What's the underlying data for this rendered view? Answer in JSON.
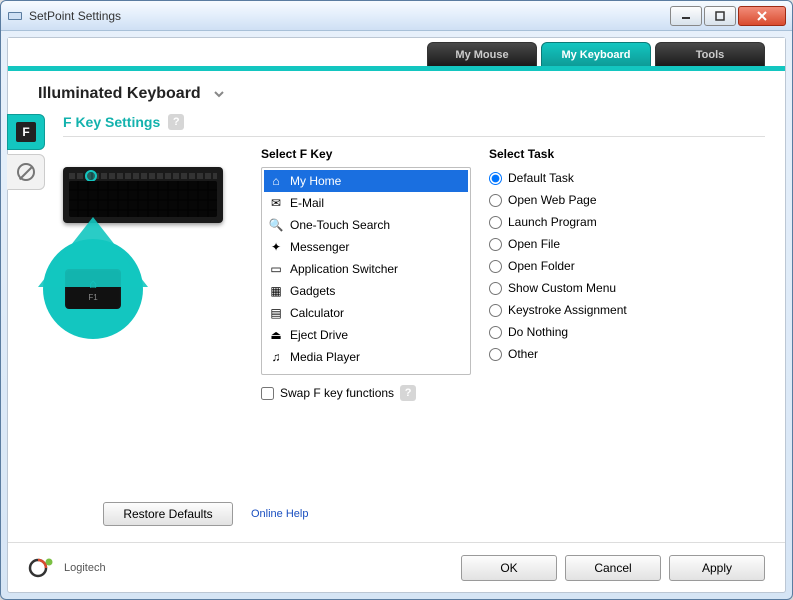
{
  "window": {
    "title": "SetPoint Settings"
  },
  "tabs": {
    "mouse": "My Mouse",
    "keyboard": "My Keyboard",
    "tools": "Tools",
    "active": "keyboard"
  },
  "device": {
    "name": "Illuminated Keyboard"
  },
  "section": {
    "title": "F Key Settings",
    "help_glyph": "?"
  },
  "zoom_key": {
    "label": "F1"
  },
  "fkey": {
    "heading": "Select F Key",
    "items": [
      {
        "icon": "home-icon",
        "glyph": "⌂",
        "label": "My Home",
        "selected": true
      },
      {
        "icon": "mail-icon",
        "glyph": "✉",
        "label": "E-Mail",
        "selected": false
      },
      {
        "icon": "search-icon",
        "glyph": "🔍",
        "label": "One-Touch Search",
        "selected": false
      },
      {
        "icon": "messenger-icon",
        "glyph": "✦",
        "label": "Messenger",
        "selected": false
      },
      {
        "icon": "appswitch-icon",
        "glyph": "▭",
        "label": "Application Switcher",
        "selected": false
      },
      {
        "icon": "gadgets-icon",
        "glyph": "▦",
        "label": "Gadgets",
        "selected": false
      },
      {
        "icon": "calculator-icon",
        "glyph": "▤",
        "label": "Calculator",
        "selected": false
      },
      {
        "icon": "eject-icon",
        "glyph": "⏏",
        "label": "Eject Drive",
        "selected": false
      },
      {
        "icon": "media-icon",
        "glyph": "♫",
        "label": "Media Player",
        "selected": false
      }
    ],
    "swap_label": "Swap F key functions",
    "swap_checked": false
  },
  "task": {
    "heading": "Select Task",
    "items": [
      {
        "label": "Default Task",
        "selected": true
      },
      {
        "label": "Open Web Page",
        "selected": false
      },
      {
        "label": "Launch Program",
        "selected": false
      },
      {
        "label": "Open File",
        "selected": false
      },
      {
        "label": "Open Folder",
        "selected": false
      },
      {
        "label": "Show Custom Menu",
        "selected": false
      },
      {
        "label": "Keystroke Assignment",
        "selected": false
      },
      {
        "label": "Do Nothing",
        "selected": false
      },
      {
        "label": "Other",
        "selected": false
      }
    ]
  },
  "buttons": {
    "restore": "Restore Defaults",
    "online_help": "Online Help",
    "ok": "OK",
    "cancel": "Cancel",
    "apply": "Apply"
  },
  "brand": {
    "name": "Logitech"
  },
  "side": {
    "f_label": "F"
  }
}
